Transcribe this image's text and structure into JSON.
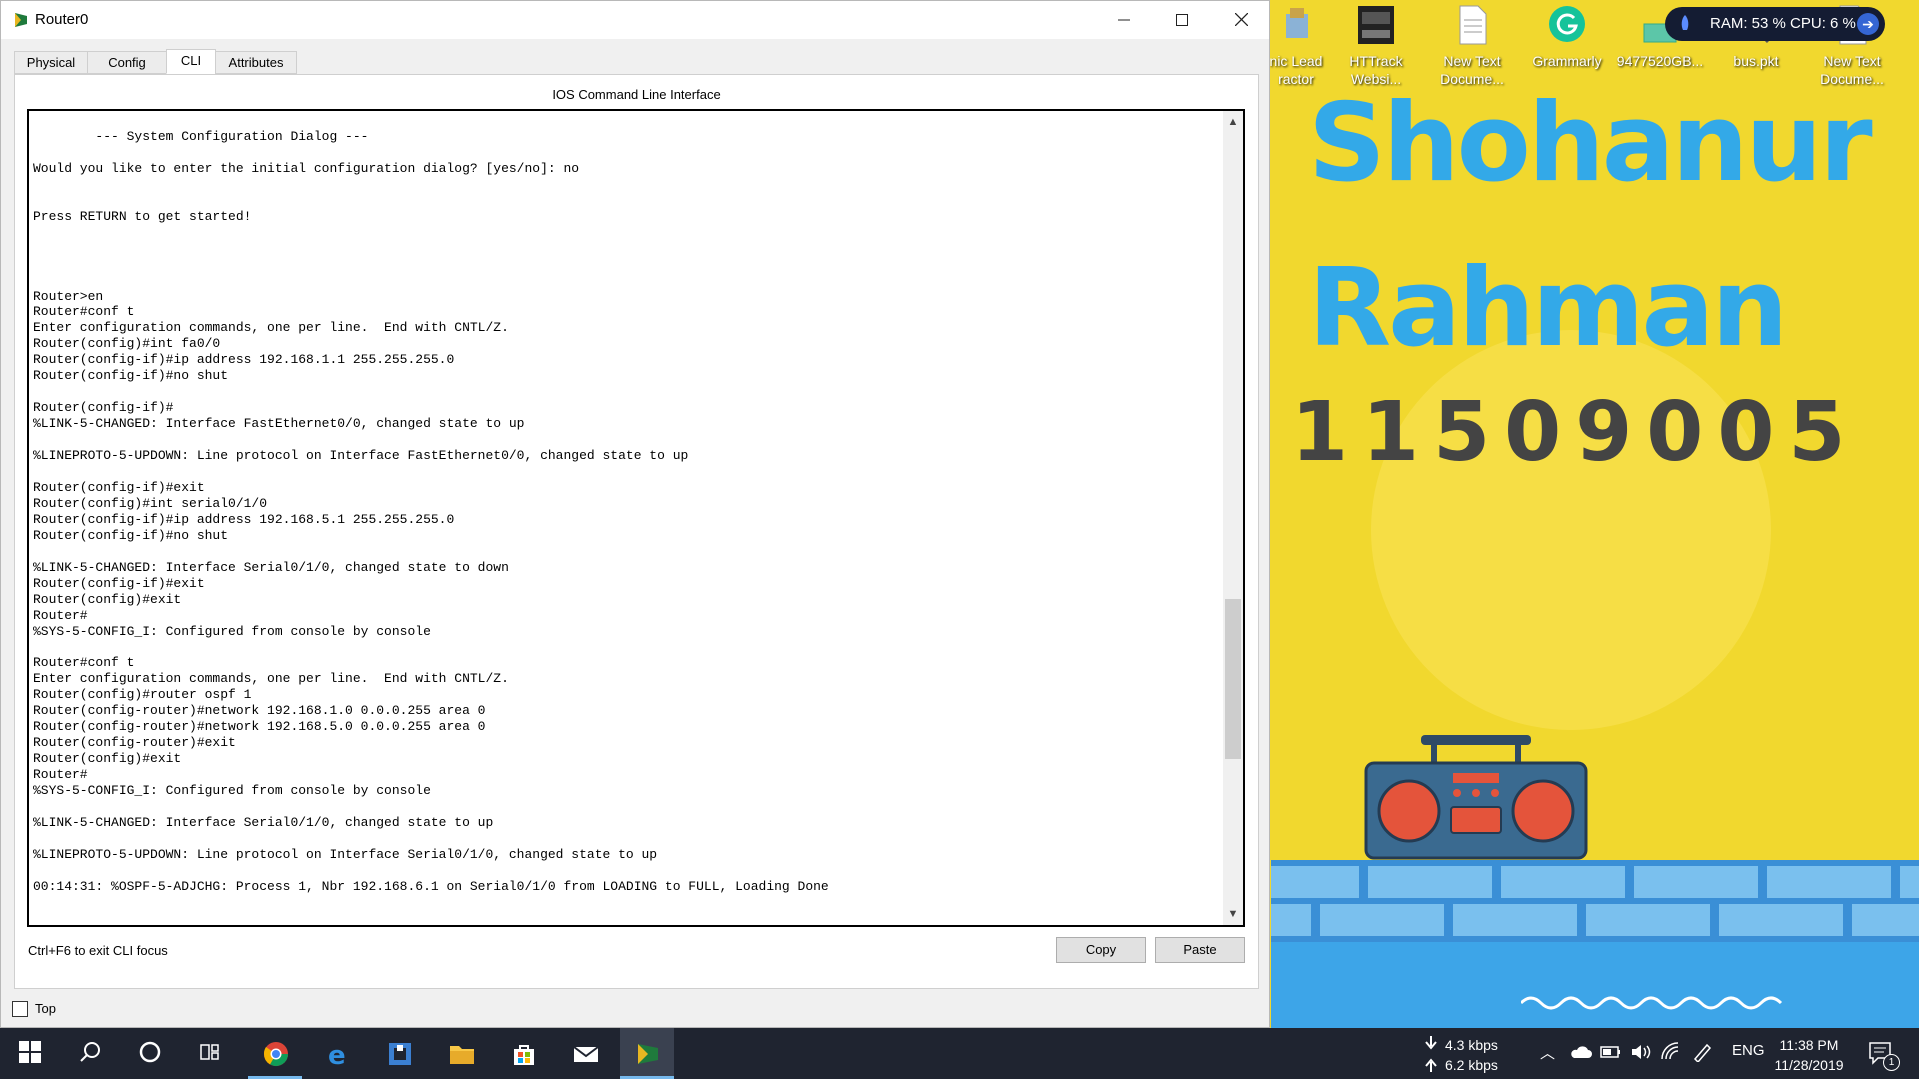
{
  "window": {
    "title": "Router0",
    "tabs": [
      "Physical",
      "Config",
      "CLI",
      "Attributes"
    ],
    "active_tab": "CLI",
    "cli_heading": "IOS Command Line Interface",
    "cli_output": "        --- System Configuration Dialog ---\n\nWould you like to enter the initial configuration dialog? [yes/no]: no\n\n\nPress RETURN to get started!\n\n\n\n\nRouter>en\nRouter#conf t\nEnter configuration commands, one per line.  End with CNTL/Z.\nRouter(config)#int fa0/0\nRouter(config-if)#ip address 192.168.1.1 255.255.255.0\nRouter(config-if)#no shut\n\nRouter(config-if)#\n%LINK-5-CHANGED: Interface FastEthernet0/0, changed state to up\n\n%LINEPROTO-5-UPDOWN: Line protocol on Interface FastEthernet0/0, changed state to up\n\nRouter(config-if)#exit\nRouter(config)#int serial0/1/0\nRouter(config-if)#ip address 192.168.5.1 255.255.255.0\nRouter(config-if)#no shut\n\n%LINK-5-CHANGED: Interface Serial0/1/0, changed state to down\nRouter(config-if)#exit\nRouter(config)#exit\nRouter#\n%SYS-5-CONFIG_I: Configured from console by console\n\nRouter#conf t\nEnter configuration commands, one per line.  End with CNTL/Z.\nRouter(config)#router ospf 1\nRouter(config-router)#network 192.168.1.0 0.0.0.255 area 0\nRouter(config-router)#network 192.168.5.0 0.0.0.255 area 0\nRouter(config-router)#exit\nRouter(config)#exit\nRouter#\n%SYS-5-CONFIG_I: Configured from console by console\n\n%LINK-5-CHANGED: Interface Serial0/1/0, changed state to up\n\n%LINEPROTO-5-UPDOWN: Line protocol on Interface Serial0/1/0, changed state to up\n\n00:14:31: %OSPF-5-ADJCHG: Process 1, Nbr 192.168.6.1 on Serial0/1/0 from LOADING to FULL, Loading Done",
    "focus_hint": "Ctrl+F6 to exit CLI focus",
    "copy_label": "Copy",
    "paste_label": "Paste",
    "top_label": "Top",
    "top_checked": false
  },
  "desktop": {
    "icons": [
      {
        "label": "nic Lead\nractor",
        "icon": "app-icon"
      },
      {
        "label": "HTTrack\nWebsi...",
        "icon": "httrack-icon"
      },
      {
        "label": "New Text\nDocume...",
        "icon": "text-file-icon"
      },
      {
        "label": "Grammarly",
        "icon": "grammarly-icon"
      },
      {
        "label": "9477520GB...",
        "icon": "image-file-icon"
      },
      {
        "label": "bus.pkt",
        "icon": "packet-tracer-file-icon"
      },
      {
        "label": "New Text\nDocume...",
        "icon": "text-file-icon"
      }
    ],
    "resource_monitor": "RAM: 53 %  CPU: 6 %",
    "wallpaper_name1": "Shohanur",
    "wallpaper_name2": "Rahman",
    "wallpaper_id": "11509005"
  },
  "taskbar": {
    "apps": [
      "start-icon",
      "search-icon",
      "cortana-icon",
      "task-view-icon",
      "chrome-icon",
      "edge-icon",
      "app-icon",
      "file-explorer-icon",
      "store-icon",
      "mail-icon",
      "packet-tracer-icon"
    ],
    "net_down": "4.3 kbps",
    "net_up": "6.2 kbps",
    "language": "ENG",
    "time": "11:38 PM",
    "date": "11/28/2019",
    "notification_count": "1"
  },
  "colors": {
    "wallpaper_yellow": "#f1d82e",
    "wallpaper_blue_text": "#33a9e8",
    "taskbar": "#1f2430"
  }
}
